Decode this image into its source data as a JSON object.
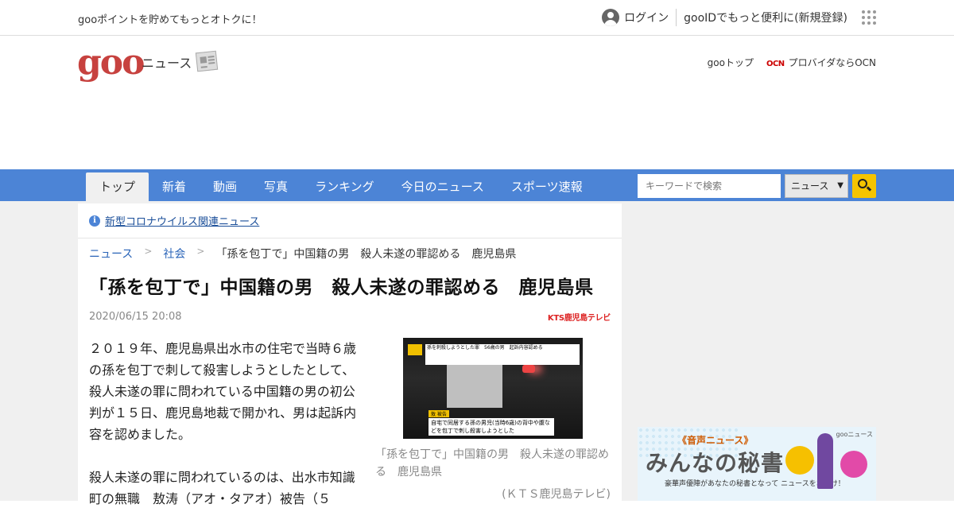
{
  "topbar": {
    "promo": "gooポイントを貯めてもっとオトクに！",
    "login": "ログイン",
    "register": "gooIDでもっと便利に(新規登録)"
  },
  "header": {
    "logo": "goo",
    "section": "ニュース",
    "goo_top": "gooトップ",
    "ocn_logo": "OCN",
    "ocn_text": "プロバイダならOCN"
  },
  "nav": {
    "tabs": [
      "トップ",
      "新着",
      "動画",
      "写真",
      "ランキング",
      "今日のニュース",
      "スポーツ速報"
    ],
    "active_index": 0,
    "search_placeholder": "キーワードで検索",
    "search_scope": "ニュース",
    "accent_color": "#4c84d6"
  },
  "article": {
    "covid_link": "新型コロナウイルス関連ニュース",
    "breadcrumb": [
      "ニュース",
      "社会",
      "「孫を包丁で」中国籍の男　殺人未遂の罪認める　鹿児島県"
    ],
    "headline": "「孫を包丁で」中国籍の男　殺人未遂の罪認める　鹿児島県",
    "date": "2020/06/15 20:08",
    "source_logo": "KTS鹿児島テレビ",
    "paragraphs": [
      "２０１９年、鹿児島県出水市の住宅で当時６歳の孫を包丁で刺して殺害しようとしたとして、殺人未遂の罪に問われている中国籍の男の初公判が１５日、鹿児島地裁で開かれ、男は起訴内容を認めました。",
      "殺人未遂の罪に問われているのは、出水市知識町の無職　敖涛（アオ・タアオ）被告（５"
    ],
    "photo": {
      "caption_top": "孫を刺殺しようとした罪　56歳の男　起訴内容認める",
      "tag": "敖 被告",
      "caption_bottom": "自宅で同居する孫の男児(当時6歳)の背中や腹などを包丁で刺し殺害しようとした",
      "caption": "「孫を包丁で」中国籍の男　殺人未遂の罪認める　鹿児島県",
      "credit": "(ＫＴＳ鹿児島テレビ)"
    }
  },
  "banner": {
    "voice": "《音声ニュース》",
    "goo_news": "gooニュース",
    "title": "みんなの秘書",
    "sub": "豪華声優陣があなたの秘書となって ニュースをお届け！"
  }
}
